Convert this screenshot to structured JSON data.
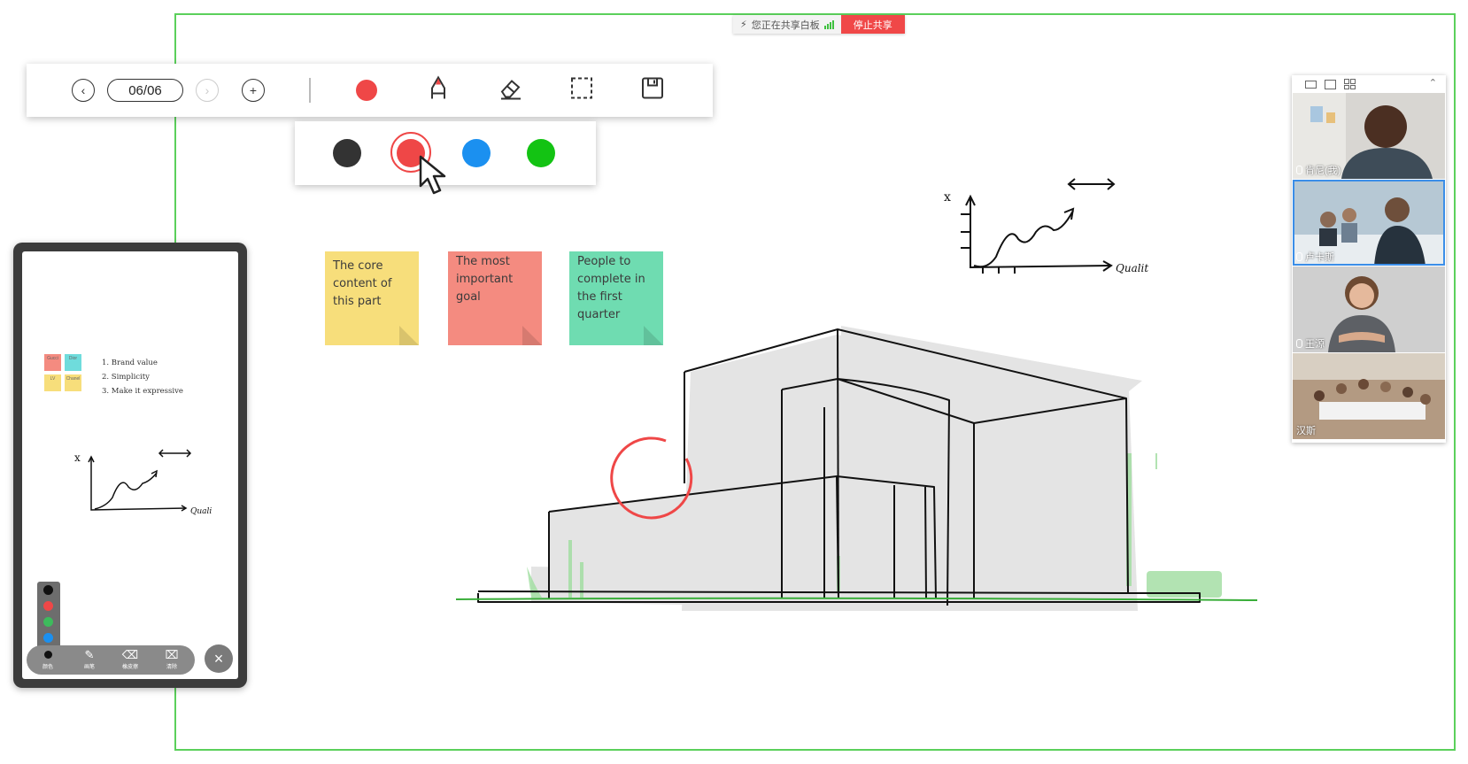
{
  "share_banner": {
    "status": "您正在共享白板",
    "stop_label": "停止共享"
  },
  "toolbar": {
    "page_indicator": "06/06",
    "current_color": "#ef4747"
  },
  "palette": {
    "colors": [
      {
        "name": "black",
        "hex": "#333333"
      },
      {
        "name": "red",
        "hex": "#ef4747"
      },
      {
        "name": "blue",
        "hex": "#1b90f0"
      },
      {
        "name": "green",
        "hex": "#13c313"
      }
    ],
    "selected": "red"
  },
  "sticky_notes": [
    {
      "text": "The core content of this part",
      "color": "#f7de7b"
    },
    {
      "text": "The most important goal",
      "color": "#f48b80"
    },
    {
      "text": "People to complete in the first quarter",
      "color": "#6fdcb1"
    }
  ],
  "canvas_chart": {
    "y_label": "x",
    "x_label": "Qualit"
  },
  "phone": {
    "mini_notes": [
      "Gucci",
      "Dior",
      "LV",
      "Chanel"
    ],
    "list": [
      "1. Brand value",
      "2. Simplicity",
      "3. Make it expressive"
    ],
    "chart_y_label": "x",
    "chart_x_label": "Quali",
    "toolbar": [
      {
        "icon": "color-dot-icon",
        "label": "颜色"
      },
      {
        "icon": "pen-icon",
        "label": "画笔"
      },
      {
        "icon": "eraser-icon",
        "label": "橡皮擦"
      },
      {
        "icon": "clear-icon",
        "label": "清除"
      }
    ]
  },
  "video_panel": {
    "participants": [
      {
        "name": "肯尼(我)",
        "active": false
      },
      {
        "name": "卢卡斯",
        "active": true
      },
      {
        "name": "王源",
        "active": false
      },
      {
        "name": "汉斯",
        "active": false
      }
    ]
  }
}
